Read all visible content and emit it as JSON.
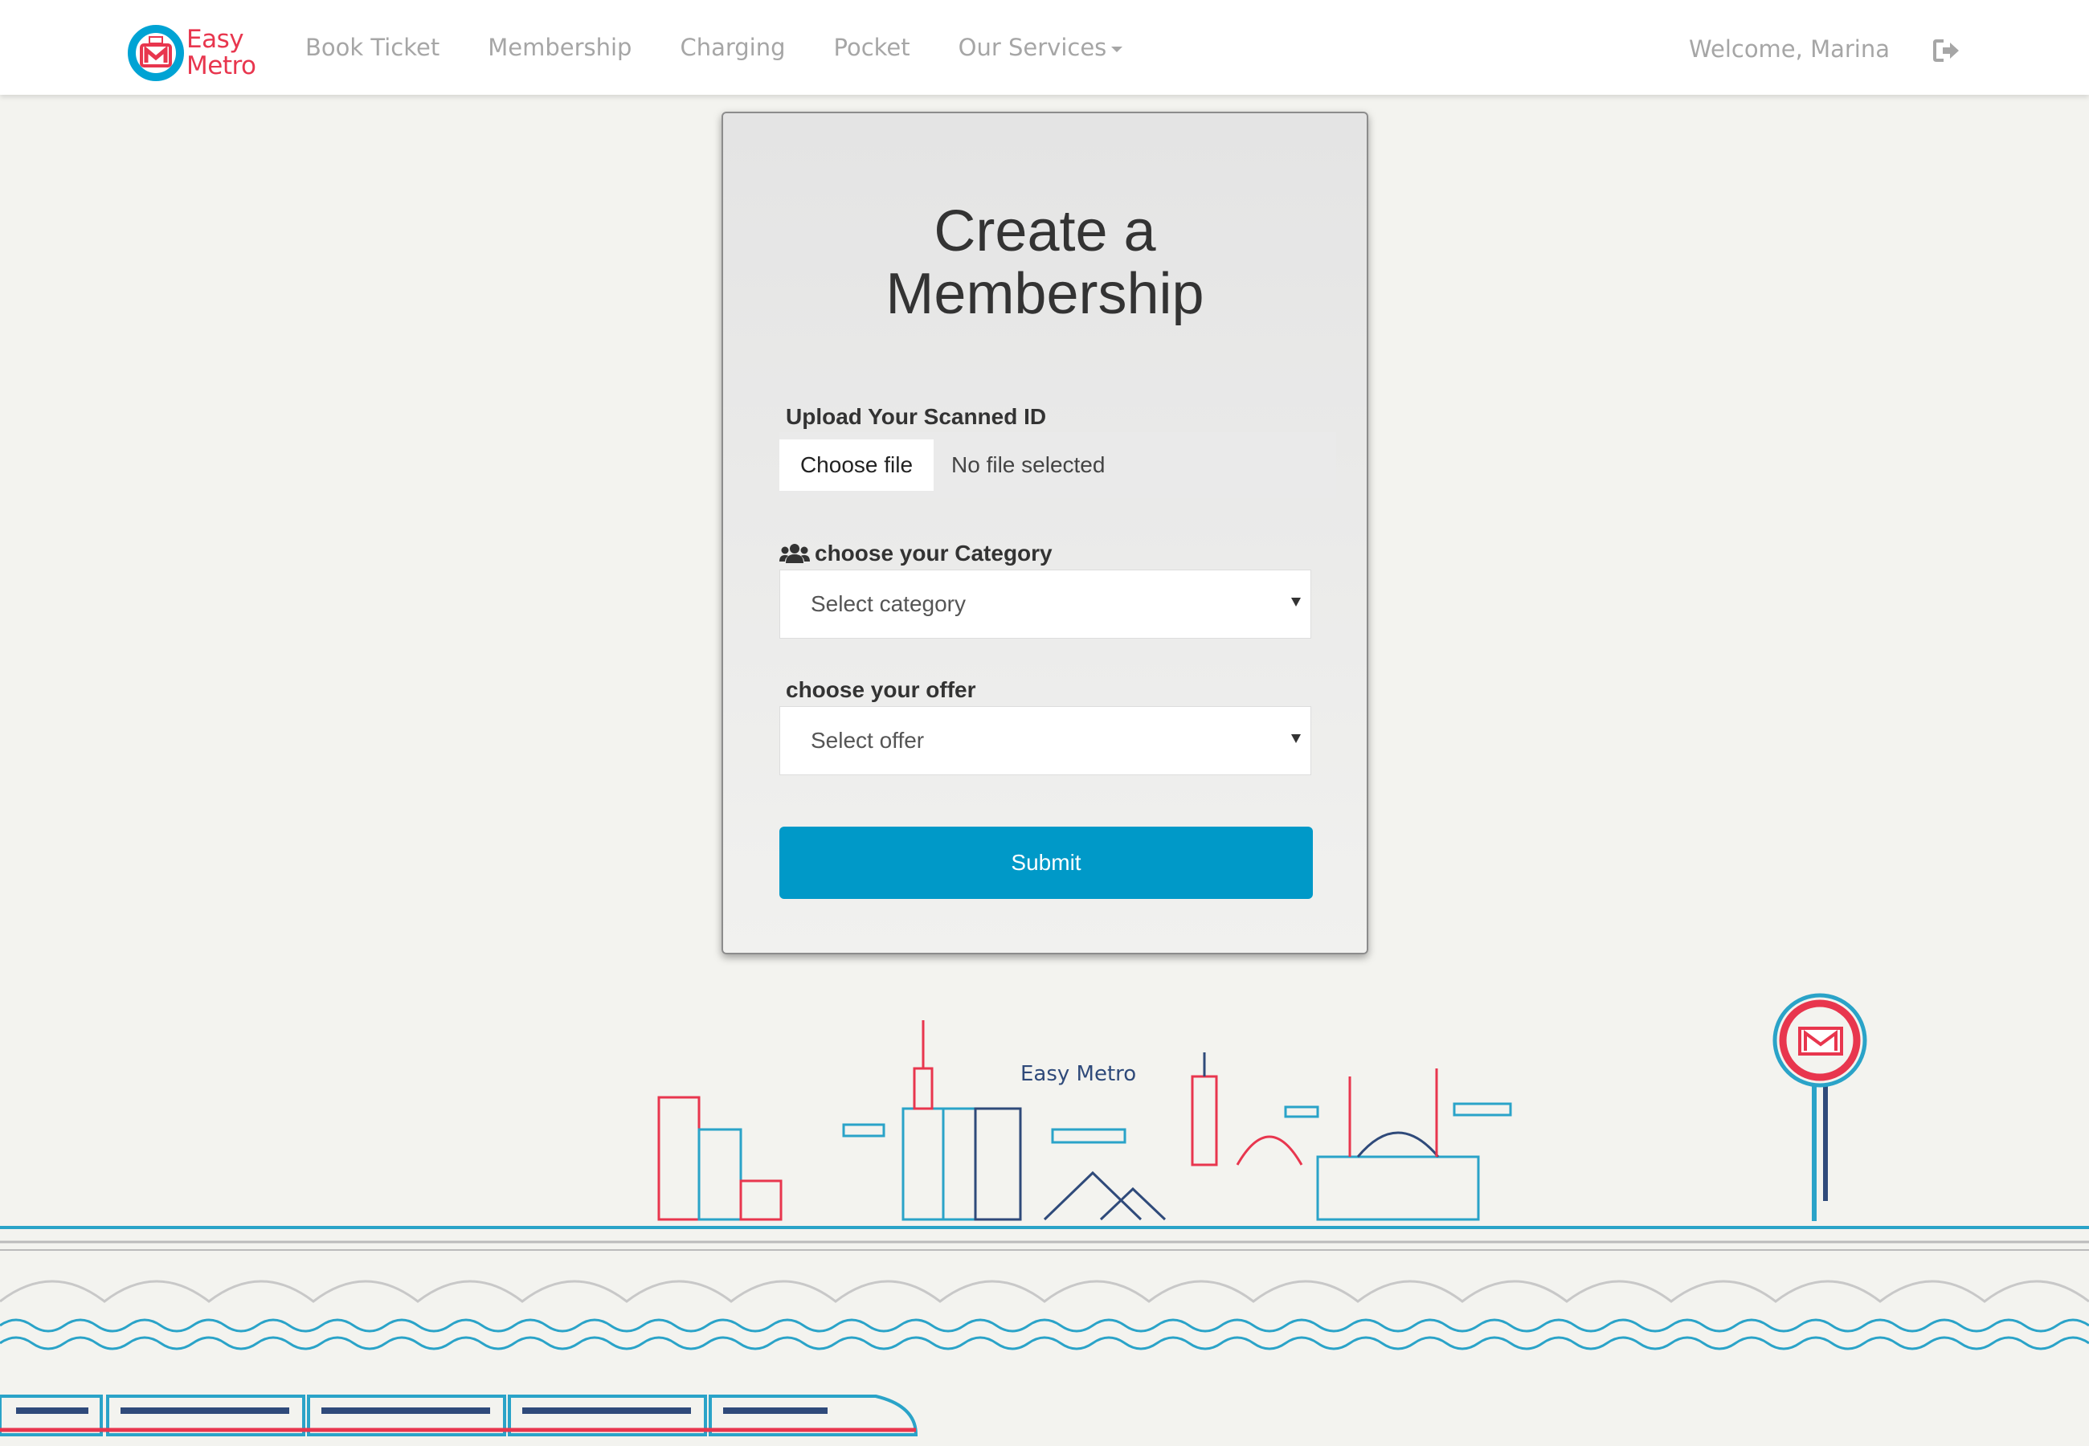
{
  "brand": {
    "line1": "Easy",
    "line2": "Metro"
  },
  "nav": {
    "links": [
      "Book Ticket",
      "Membership",
      "Charging",
      "Pocket",
      "Our Services"
    ],
    "welcome": "Welcome, Marina",
    "logout_icon": "sign-out-icon"
  },
  "form": {
    "title_line1": "Create a",
    "title_line2": "Membership",
    "upload_label": "Upload Your Scanned ID",
    "file_button": "Choose file",
    "file_status": "No file selected",
    "category_label": "choose your Category",
    "category_icon": "users-icon",
    "category_selected": "Select category",
    "offer_label": "choose your offer",
    "offer_selected": "Select offer",
    "submit": "Submit"
  },
  "scenery": {
    "caption": "Easy Metro"
  },
  "colors": {
    "accent": "#0099c8",
    "brand_red": "#e8364e",
    "navy": "#2f4a7a",
    "nav_text": "#a6a6a6"
  }
}
